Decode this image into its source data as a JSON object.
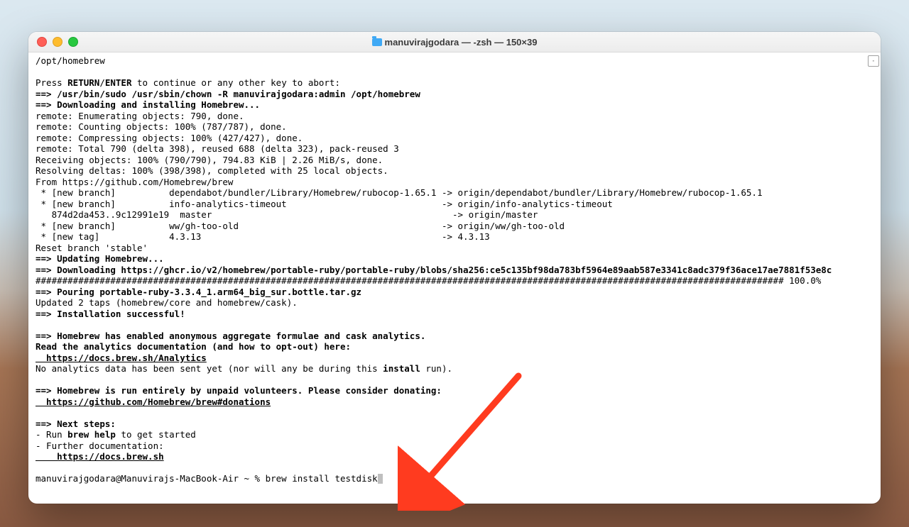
{
  "window": {
    "title": "manuvirajgodara — -zsh — 150×39"
  },
  "terminal": {
    "l01": "/opt/homebrew",
    "l02": "",
    "l03a": "Press ",
    "l03b": "RETURN",
    "l03c": "/",
    "l03d": "ENTER",
    "l03e": " to continue or any other key to abort:",
    "l04a": "==> ",
    "l04b": "/usr/bin/sudo /usr/sbin/chown -R manuvirajgodara:admin /opt/homebrew",
    "l05a": "==> ",
    "l05b": "Downloading and installing Homebrew...",
    "l06": "remote: Enumerating objects: 790, done.",
    "l07": "remote: Counting objects: 100% (787/787), done.",
    "l08": "remote: Compressing objects: 100% (427/427), done.",
    "l09": "remote: Total 790 (delta 398), reused 688 (delta 323), pack-reused 3",
    "l10": "Receiving objects: 100% (790/790), 794.83 KiB | 2.26 MiB/s, done.",
    "l11": "Resolving deltas: 100% (398/398), completed with 25 local objects.",
    "l12": "From https://github.com/Homebrew/brew",
    "l13": " * [new branch]          dependabot/bundler/Library/Homebrew/rubocop-1.65.1 -> origin/dependabot/bundler/Library/Homebrew/rubocop-1.65.1",
    "l14": " * [new branch]          info-analytics-timeout                             -> origin/info-analytics-timeout",
    "l15": "   874d2da453..9c12991e19  master                                             -> origin/master",
    "l16": " * [new branch]          ww/gh-too-old                                      -> origin/ww/gh-too-old",
    "l17": " * [new tag]             4.3.13                                             -> 4.3.13",
    "l18": "Reset branch 'stable'",
    "l19a": "==> ",
    "l19b": "Updating Homebrew...",
    "l20a": "==> ",
    "l20b": "Downloading https://ghcr.io/v2/homebrew/portable-ruby/portable-ruby/blobs/sha256:ce5c135bf98da783bf5964e89aab587e3341c8adc379f36ace17ae7881f53e8c",
    "l21": "############################################################################################################################################ 100.0%",
    "l22a": "==> ",
    "l22b": "Pouring portable-ruby-3.3.4_1.arm64_big_sur.bottle.tar.gz",
    "l23": "Updated 2 taps (homebrew/core and homebrew/cask).",
    "l24a": "==> ",
    "l24b": "Installation successful!",
    "l25": "",
    "l26a": "==> ",
    "l26b": "Homebrew has enabled anonymous aggregate formulae and cask analytics.",
    "l27": "Read the analytics documentation (and how to opt-out) here:",
    "l28": "  https://docs.brew.sh/Analytics",
    "l29a": "No analytics data has been sent yet (nor will any be during this ",
    "l29b": "install",
    "l29c": " run).",
    "l30": "",
    "l31a": "==> ",
    "l31b": "Homebrew is run entirely by unpaid volunteers. Please consider donating:",
    "l32": "  https://github.com/Homebrew/brew#donations",
    "l33": "",
    "l34a": "==> ",
    "l34b": "Next steps:",
    "l35a": "- Run ",
    "l35b": "brew help",
    "l35c": " to get started",
    "l36": "- Further documentation:",
    "l37": "    https://docs.brew.sh",
    "l38": "",
    "prompt": "manuvirajgodara@Manuvirajs-MacBook-Air ~ % ",
    "command": "brew install testdisk"
  }
}
